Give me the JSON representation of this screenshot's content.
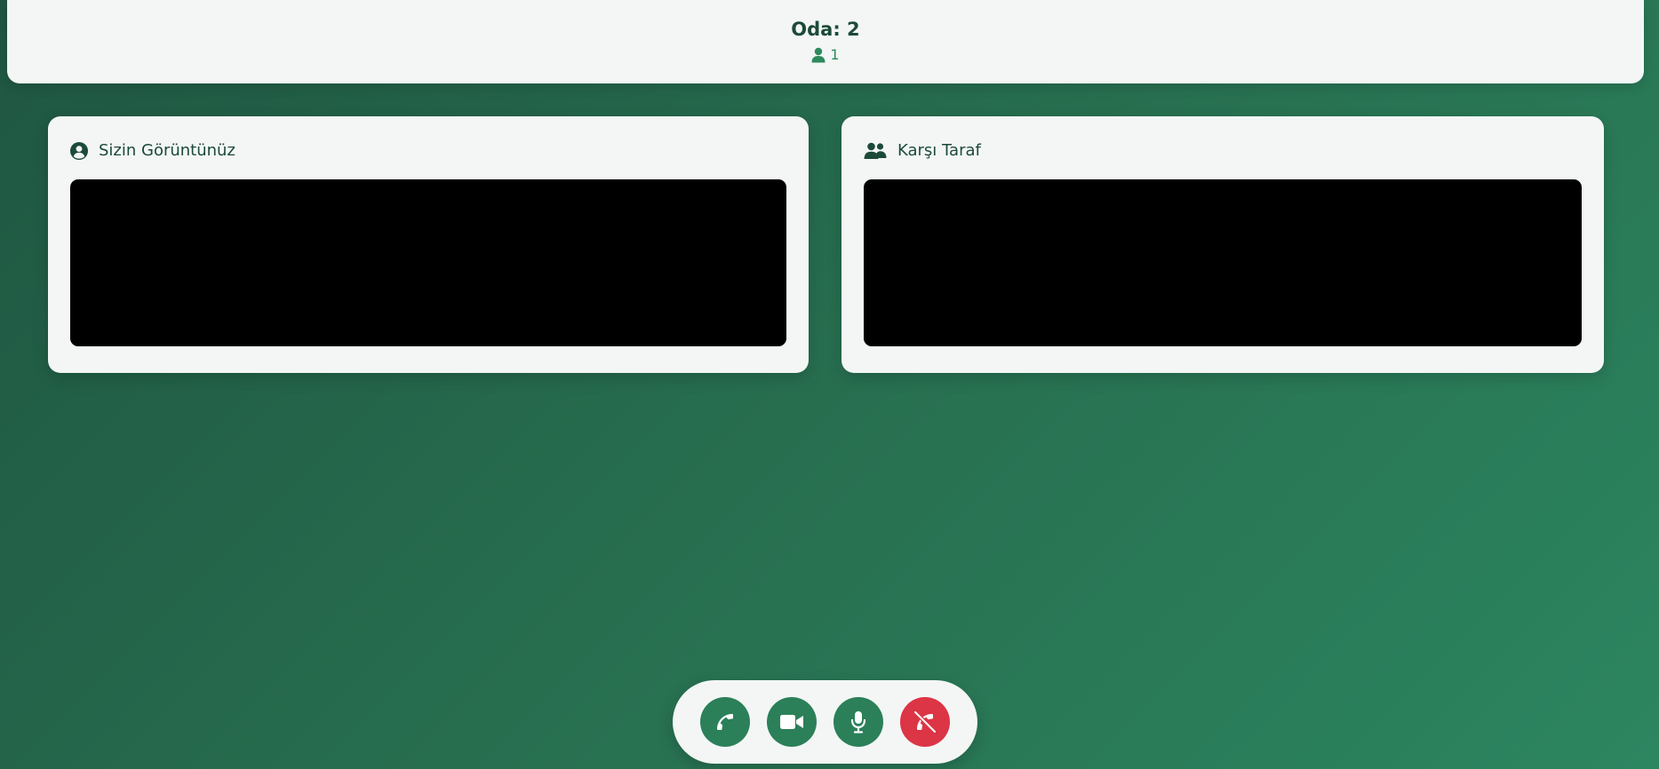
{
  "header": {
    "room_title": "Oda: 2",
    "participant_count": "1",
    "participant_icon": "user-icon"
  },
  "panels": {
    "local": {
      "title": "Sizin Görüntünüz",
      "icon": "user-circle-icon"
    },
    "remote": {
      "title": "Karşı Taraf",
      "icon": "users-icon"
    }
  },
  "controls": [
    {
      "name": "call-button",
      "icon": "phone-icon"
    },
    {
      "name": "camera-button",
      "icon": "video-camera-icon"
    },
    {
      "name": "mic-button",
      "icon": "microphone-icon"
    },
    {
      "name": "end-call-button",
      "icon": "phone-slash-icon"
    }
  ],
  "colors": {
    "accent": "#2b8059",
    "danger": "#dc3545",
    "text_dark": "#1c4a38",
    "card_bg": "#f3f6f5"
  }
}
